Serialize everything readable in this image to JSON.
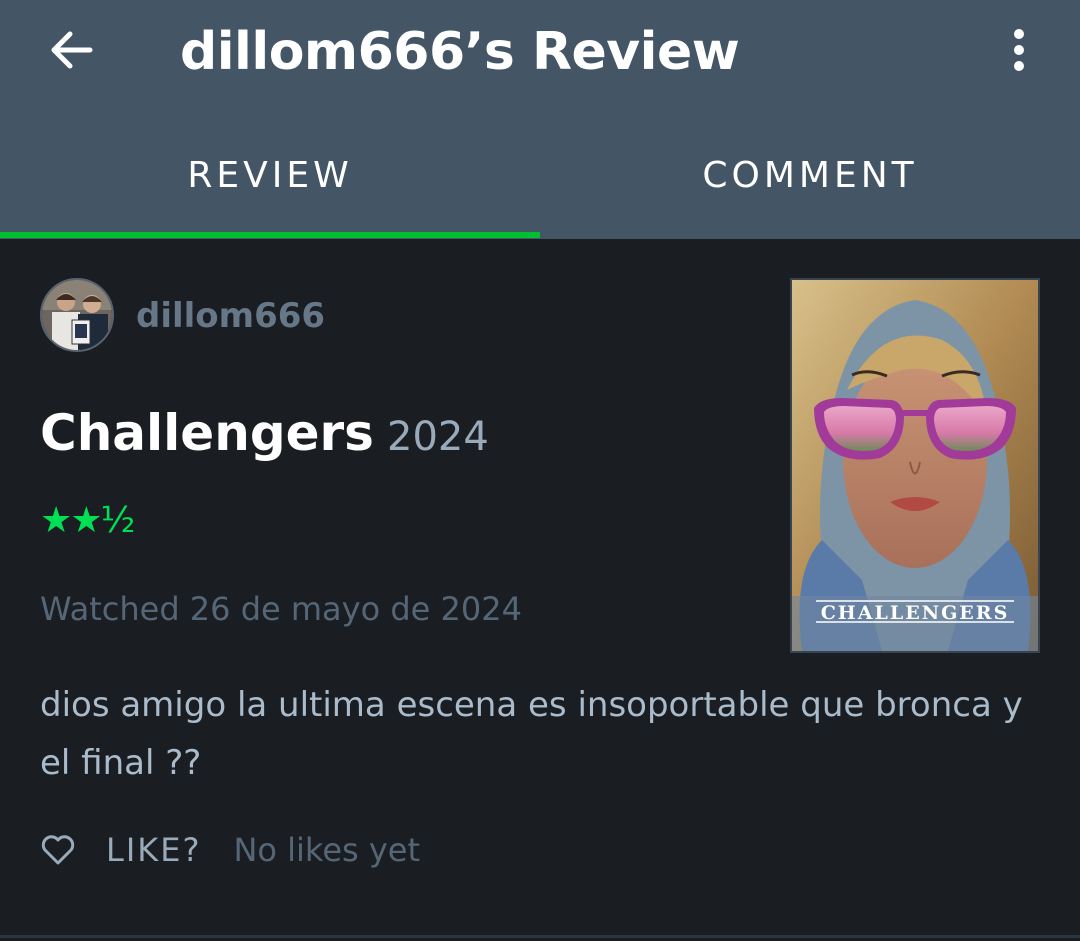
{
  "header": {
    "title": "dillom666’s Review",
    "back_icon": "arrow-left-icon",
    "more_icon": "more-vertical-icon"
  },
  "tabs": [
    {
      "label": "REVIEW",
      "active": true
    },
    {
      "label": "COMMENT",
      "active": false
    }
  ],
  "review": {
    "username": "dillom666",
    "film_title": "Challengers",
    "film_year": "2024",
    "rating_display": "★★½",
    "rating_value": 2.5,
    "rating_max": 5,
    "watched": "Watched 26 de mayo de 2024",
    "text": "dios amigo la ultima escena es insoportable que bronca y el final ??",
    "like_label": "LIKE?",
    "likes_status": "No likes yet"
  },
  "poster": {
    "title_text": "CHALLENGERS"
  },
  "colors": {
    "header_bg": "#445566",
    "page_bg": "#1a1d22",
    "accent_green": "#00e054",
    "tab_indicator": "#00c030"
  }
}
